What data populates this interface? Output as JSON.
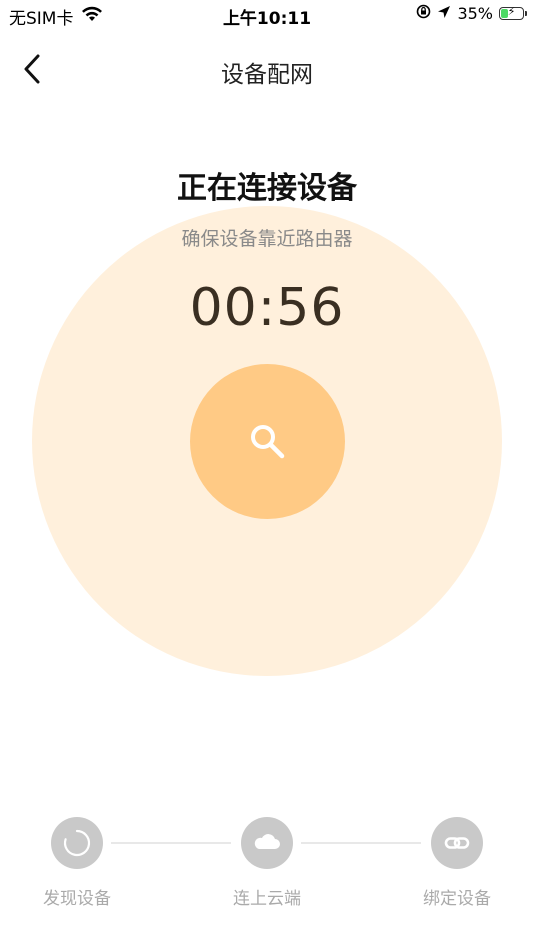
{
  "status_bar": {
    "carrier": "无SIM卡",
    "time": "上午10:11",
    "battery": "35%",
    "battery_level": 0.35
  },
  "nav": {
    "title": "设备配网"
  },
  "connect": {
    "headline": "正在连接设备",
    "hint": "确保设备靠近路由器",
    "timer": "00:56"
  },
  "steps": [
    {
      "label": "发现设备",
      "icon": "loading-ring-icon"
    },
    {
      "label": "连上云端",
      "icon": "cloud-icon"
    },
    {
      "label": "绑定设备",
      "icon": "link-icon"
    }
  ],
  "colors": {
    "outer_circle": "#fff0dc",
    "search_circle": "#ffca85",
    "step_inactive": "#c9c9c9",
    "battery_fill": "#4cd964"
  }
}
